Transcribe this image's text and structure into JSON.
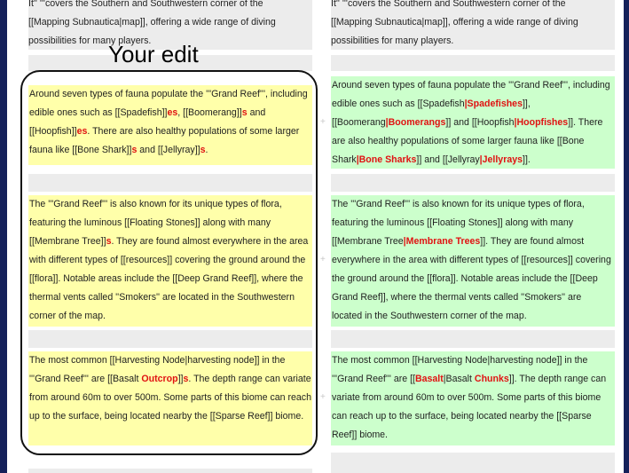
{
  "annotation": {
    "label": "Your edit"
  },
  "diff": {
    "left": {
      "top": [
        "It'' '''covers the Southern and Southwestern corner of the",
        "[[Mapping Subnautica|map]], offering a wide range of diving",
        "possibilities for many players."
      ],
      "para1": {
        "t1": "Around seven types of fauna populate the '''Grand Reef''', including edible ones such as [[Spadefish]]",
        "h1": "es",
        "t2": ", [[Boomerang]]",
        "h2": "s",
        "t3": " and [[Hoopfish]]",
        "h3": "es",
        "t4": ". There are also healthy populations of some larger fauna like [[Bone Shark]]",
        "h4": "s",
        "t5": " and [[Jellyray]]",
        "h5": "s",
        "t6": "."
      },
      "para2": {
        "t1": "The '''Grand Reef''' is also known for its unique types of flora, featuring the luminous [[Floating Stones]] along with many [[Membrane Tree]]",
        "h1": "s",
        "t2": ". They are found almost everywhere in the area with different types of [[resources]] covering the ground around the [[flora]]. Notable areas include the [[Deep Grand Reef]], where the thermal vents called ''Smokers'' are located in the Southwestern corner of the map."
      },
      "para3": {
        "t1": "The most common [[Harvesting Node|harvesting node]] in the '''Grand Reef''' are [[Basalt ",
        "h1": "Outcrop",
        "t2": "]]",
        "h2": "s",
        "t3": ". The depth range can variate from around 60m to over 500m. Some parts of this biome can reach up to the surface, being located nearby the [[Sparse Reef]] biome."
      }
    },
    "right": {
      "top": [
        "It'' '''covers the Southern and Southwestern corner of the",
        "[[Mapping Subnautica|map]], offering a wide range of diving",
        "possibilities for many players."
      ],
      "para1": {
        "t1": "Around seven types of fauna populate the '''Grand Reef''', including edible ones such as [[Spadefish",
        "h1": "|Spadefishes",
        "t2": "]], [[Boomerang",
        "h2": "|Boomerangs",
        "t3": "]] and [[Hoopfish",
        "h3": "|Hoopfishes",
        "t4": "]]. There are also healthy populations of some larger fauna like [[Bone Shark",
        "h4": "|Bone Sharks",
        "t5": "]] and [[Jellyray",
        "h5": "|Jellyrays",
        "t6": "]]."
      },
      "para2": {
        "t1": "The '''Grand Reef''' is also known for its unique types of flora, featuring the luminous [[Floating Stones]] along with many [[Membrane Tree",
        "h1": "|Membrane Trees",
        "t2": "]]. They are found almost everywhere in the area with different types of [[resources]] covering the ground around the [[flora]]. Notable areas include the [[Deep Grand Reef]], where the thermal vents called ''Smokers'' are located in the Southwestern corner of the map."
      },
      "para3": {
        "t1": "The most common [[Harvesting Node|harvesting node]] in the '''Grand Reef''' are [[",
        "h1": "Basalt",
        "t2": "|Basalt ",
        "h2": "Chunks",
        "t3": "]]. The depth range can variate from around 60m to over 500m. Some parts of this biome can reach up to the surface, being located nearby the [[Sparse Reef]] biome."
      }
    },
    "marker": "+"
  },
  "colors": {
    "removed_bg": "#ffffaa",
    "added_bg": "#ccffcc",
    "context_bg": "#ececec",
    "highlight": "#e01212",
    "frame": "#15215a"
  }
}
